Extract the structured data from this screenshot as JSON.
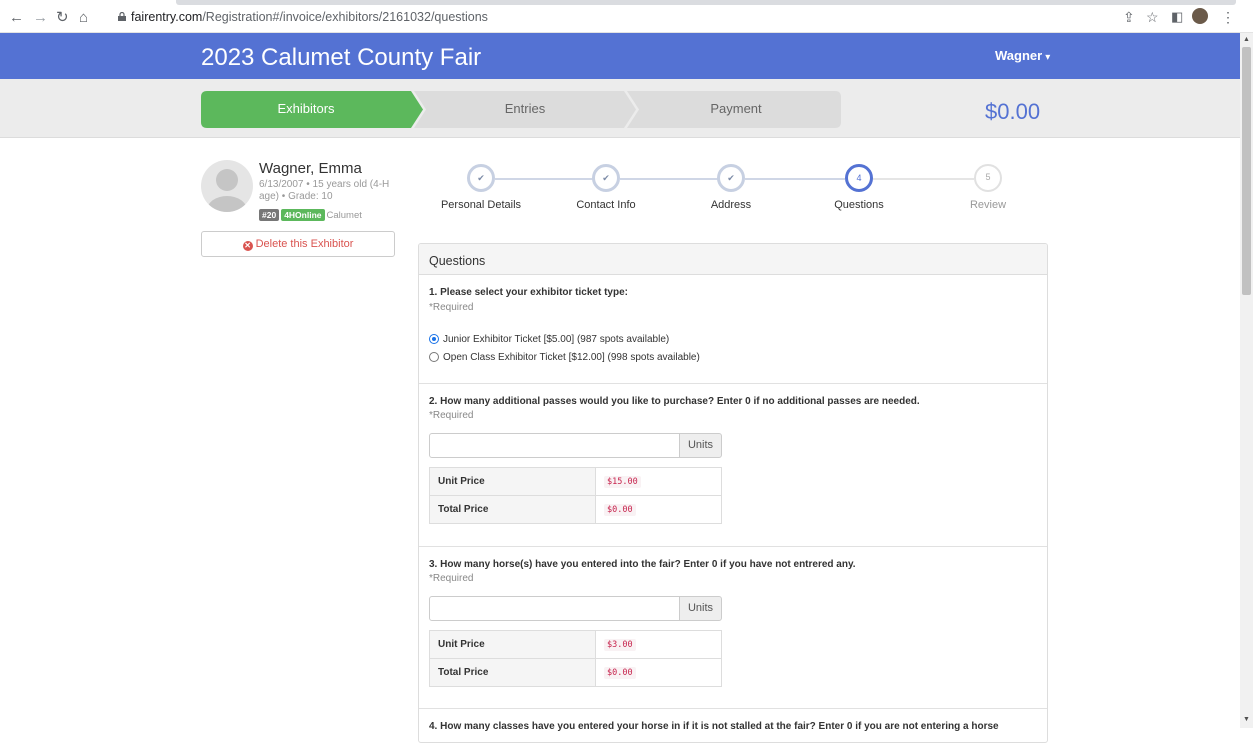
{
  "browser": {
    "url_host": "fairentry.com",
    "url_path": "/Registration#/invoice/exhibitors/2161032/questions"
  },
  "header": {
    "title": "2023 Calumet County Fair",
    "user": "Wagner"
  },
  "steps": {
    "items": [
      {
        "label": "Exhibitors"
      },
      {
        "label": "Entries"
      },
      {
        "label": "Payment"
      }
    ],
    "total": "$0.00"
  },
  "exhibitor": {
    "name": "Wagner, Emma",
    "details": "6/13/2007 • 15 years old (4-H age) • Grade: 10",
    "badge_number": "#20",
    "badge_program": "4HOnline",
    "county": "Calumet",
    "delete_label": "Delete this Exhibitor"
  },
  "wizard": {
    "steps": [
      {
        "label": "Personal Details",
        "mark": "✔"
      },
      {
        "label": "Contact Info",
        "mark": "✔"
      },
      {
        "label": "Address",
        "mark": "✔"
      },
      {
        "label": "Questions",
        "mark": "4"
      },
      {
        "label": "Review",
        "mark": "5"
      }
    ]
  },
  "panel": {
    "title": "Questions",
    "questions": [
      {
        "title": "1. Please select your exhibitor ticket type:",
        "required": "*Required",
        "options": [
          "Junior Exhibitor Ticket [$5.00] (987 spots available)",
          "Open Class Exhibitor Ticket [$12.00] (998 spots available)"
        ]
      },
      {
        "title": "2. How many additional passes would you like to purchase? Enter 0 if no additional passes are needed.",
        "required": "*Required",
        "units": "Units",
        "unit_price_label": "Unit Price",
        "unit_price": "$15.00",
        "total_price_label": "Total Price",
        "total_price": "$0.00"
      },
      {
        "title": "3. How many horse(s) have you entered into the fair? Enter 0 if you have not entrered any.",
        "required": "*Required",
        "units": "Units",
        "unit_price_label": "Unit Price",
        "unit_price": "$3.00",
        "total_price_label": "Total Price",
        "total_price": "$0.00"
      },
      {
        "title": "4. How many classes have you entered your horse in if it is not stalled at the fair? Enter 0 if you are not entering a horse"
      }
    ]
  }
}
